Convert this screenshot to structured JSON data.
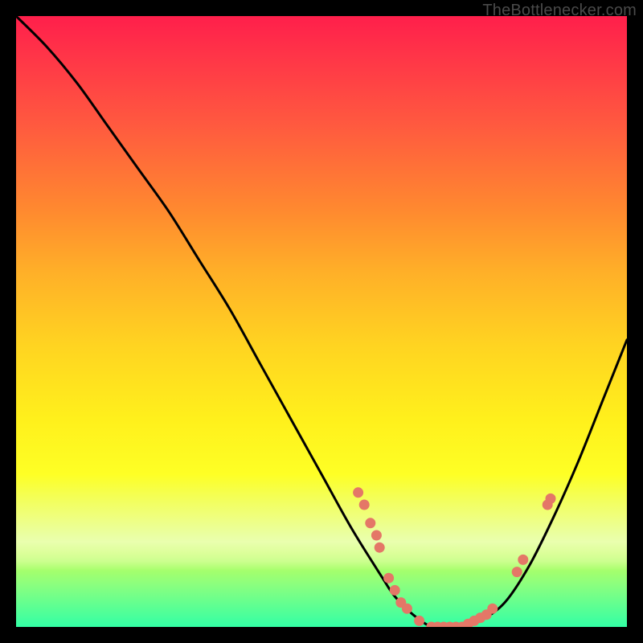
{
  "watermark": {
    "text": "TheBottlenecker.com"
  },
  "chart_data": {
    "type": "line",
    "title": "",
    "xlabel": "",
    "ylabel": "",
    "xlim": [
      0,
      100
    ],
    "ylim": [
      0,
      100
    ],
    "x": [
      0,
      5,
      10,
      15,
      20,
      25,
      30,
      35,
      40,
      45,
      50,
      55,
      60,
      62,
      65,
      68,
      70,
      73,
      76,
      80,
      84,
      88,
      92,
      96,
      100
    ],
    "values": [
      100,
      95,
      89,
      82,
      75,
      68,
      60,
      52,
      43,
      34,
      25,
      16,
      8,
      5,
      2,
      0,
      0,
      0,
      1,
      4,
      10,
      18,
      27,
      37,
      47
    ],
    "markers": [
      {
        "x": 56,
        "y": 22
      },
      {
        "x": 57,
        "y": 20
      },
      {
        "x": 58,
        "y": 17
      },
      {
        "x": 59,
        "y": 15
      },
      {
        "x": 59.5,
        "y": 13
      },
      {
        "x": 61,
        "y": 8
      },
      {
        "x": 62,
        "y": 6
      },
      {
        "x": 63,
        "y": 4
      },
      {
        "x": 64,
        "y": 3
      },
      {
        "x": 66,
        "y": 1
      },
      {
        "x": 68,
        "y": 0
      },
      {
        "x": 69,
        "y": 0
      },
      {
        "x": 70,
        "y": 0
      },
      {
        "x": 71,
        "y": 0
      },
      {
        "x": 72,
        "y": 0
      },
      {
        "x": 73,
        "y": 0
      },
      {
        "x": 74,
        "y": 0.5
      },
      {
        "x": 75,
        "y": 1
      },
      {
        "x": 76,
        "y": 1.5
      },
      {
        "x": 77,
        "y": 2
      },
      {
        "x": 78,
        "y": 3
      },
      {
        "x": 82,
        "y": 9
      },
      {
        "x": 83,
        "y": 11
      },
      {
        "x": 87,
        "y": 20
      },
      {
        "x": 87.5,
        "y": 21
      }
    ],
    "gradient_stops": [
      {
        "pos": 0.0,
        "color": "#ff1f4b"
      },
      {
        "pos": 0.18,
        "color": "#ff5a3f"
      },
      {
        "pos": 0.42,
        "color": "#ffb028"
      },
      {
        "pos": 0.66,
        "color": "#fff01c"
      },
      {
        "pos": 0.88,
        "color": "#c4ff56"
      },
      {
        "pos": 1.0,
        "color": "#33ffa5"
      }
    ],
    "marker_color": "#e47767",
    "curve_color": "#000000"
  }
}
